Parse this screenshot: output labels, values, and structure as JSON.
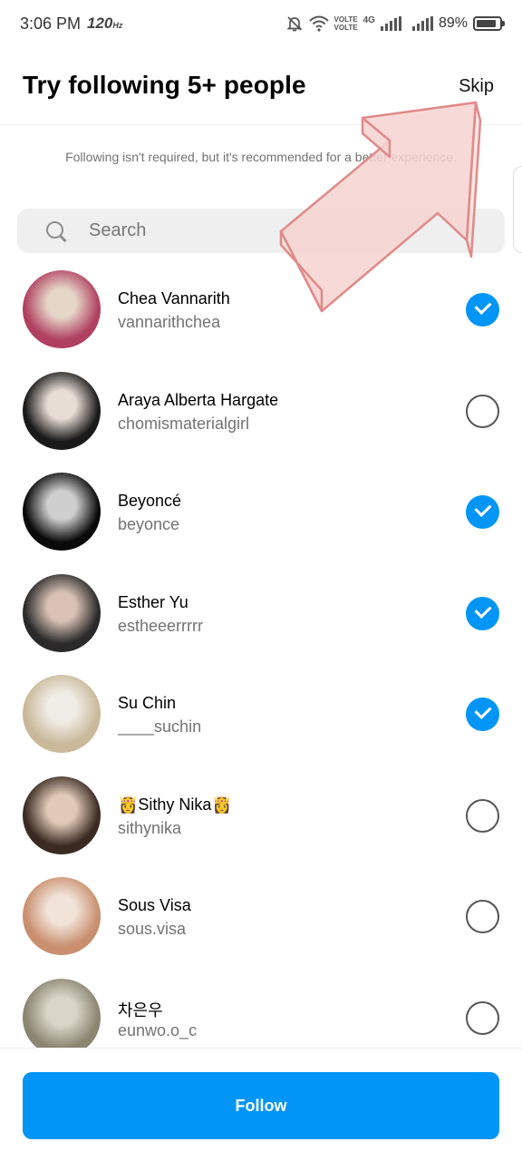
{
  "status_bar": {
    "time": "3:06 PM",
    "refresh_rate": "120",
    "volte_1": "VOLTE",
    "volte_2": "VOLTE",
    "network": "4G",
    "battery_percent": "89%",
    "battery_level": 0.89,
    "icons": [
      "mute-bell-icon",
      "wifi-icon",
      "signal-icon",
      "battery-icon"
    ]
  },
  "header": {
    "title": "Try following 5+ people",
    "skip_label": "Skip"
  },
  "subtitle": "Following isn't required, but it's recommended for a better experience.",
  "search": {
    "placeholder": "Search",
    "value": ""
  },
  "people": [
    {
      "name": "Chea Vannarith",
      "username": "vannarithchea",
      "selected": true,
      "avatar_colors": [
        "#b04060",
        "#e6d6c8"
      ]
    },
    {
      "name": "Araya Alberta Hargate",
      "username": "chomismaterialgirl",
      "selected": false,
      "avatar_colors": [
        "#1a1a1a",
        "#e8ddd5"
      ]
    },
    {
      "name": "Beyoncé",
      "username": "beyonce",
      "selected": true,
      "avatar_colors": [
        "#0a0a0a",
        "#cfcfcf"
      ]
    },
    {
      "name": "Esther Yu",
      "username": "estheeerrrrr",
      "selected": true,
      "avatar_colors": [
        "#2a2a2a",
        "#d9c2b5"
      ]
    },
    {
      "name": "Su Chin",
      "username": "____suchin",
      "selected": true,
      "avatar_colors": [
        "#c9b99a",
        "#f0ece6"
      ]
    },
    {
      "name": "👸Sithy Nika👸",
      "username": "sithynika",
      "selected": false,
      "avatar_colors": [
        "#3a2a22",
        "#e0c9b8"
      ]
    },
    {
      "name": "Sous Visa",
      "username": "sous.visa",
      "selected": false,
      "avatar_colors": [
        "#c98f6f",
        "#f2e3d8"
      ]
    },
    {
      "name": "차은우",
      "username": "eunwo.o_c",
      "selected": false,
      "avatar_colors": [
        "#8a8570",
        "#d9d6c8"
      ]
    }
  ],
  "footer": {
    "follow_label": "Follow"
  },
  "colors": {
    "accent": "#0095f6",
    "muted_text": "#737373",
    "search_bg": "#efefef",
    "annotation_arrow": "#e8a0a0"
  }
}
